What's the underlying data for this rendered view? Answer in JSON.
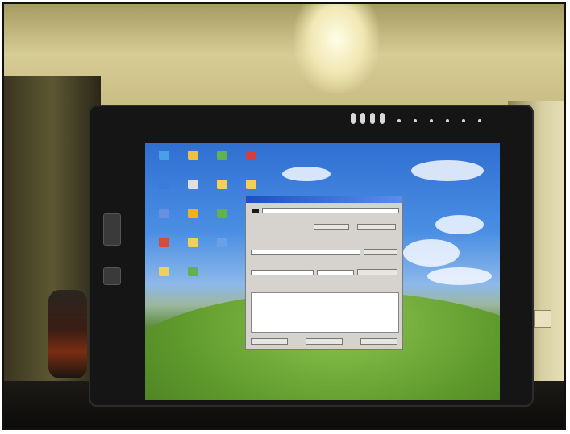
{
  "photo": {
    "subject": ""
  },
  "desktop": {
    "icons": [
      {
        "name": "icon-1",
        "color": "#4aa0e8"
      },
      {
        "name": "icon-2",
        "color": "#f0c040"
      },
      {
        "name": "icon-3",
        "color": "#5fb34a"
      },
      {
        "name": "icon-4",
        "color": "#d04040"
      },
      {
        "name": "icon-5",
        "color": "#3a7ad8"
      },
      {
        "name": "icon-6",
        "color": "#e0e0e0"
      },
      {
        "name": "icon-7",
        "color": "#f2cf58"
      },
      {
        "name": "icon-8",
        "color": "#f2cf58"
      },
      {
        "name": "icon-9",
        "color": "#6a8fe0"
      },
      {
        "name": "icon-10",
        "color": "#f0b020"
      },
      {
        "name": "icon-11",
        "color": "#5fb34a"
      },
      {
        "name": "icon-12",
        "color": "#e0e0e0"
      },
      {
        "name": "icon-13",
        "color": "#d84a3a"
      },
      {
        "name": "icon-14",
        "color": "#f2cf58"
      },
      {
        "name": "icon-15",
        "color": "#6aa0e8"
      },
      {
        "name": "icon-16",
        "color": "#e0e0e0"
      },
      {
        "name": "icon-17",
        "color": "#f2cf58"
      },
      {
        "name": "icon-18",
        "color": "#5fb34a"
      }
    ]
  },
  "dialog": {
    "title": "",
    "printer_select": "",
    "mode_label": "",
    "mode_value": "",
    "btn_a": "",
    "btn_b": "",
    "function_label": "",
    "function_select": "",
    "execute_button": "",
    "parameter_label": "",
    "parameter_select": "",
    "parameter_value": "",
    "change_param_button": "",
    "status_label": "",
    "log_lines": [
      "",
      ""
    ],
    "footer_left": "",
    "footer_mid": "",
    "footer_right": ""
  }
}
